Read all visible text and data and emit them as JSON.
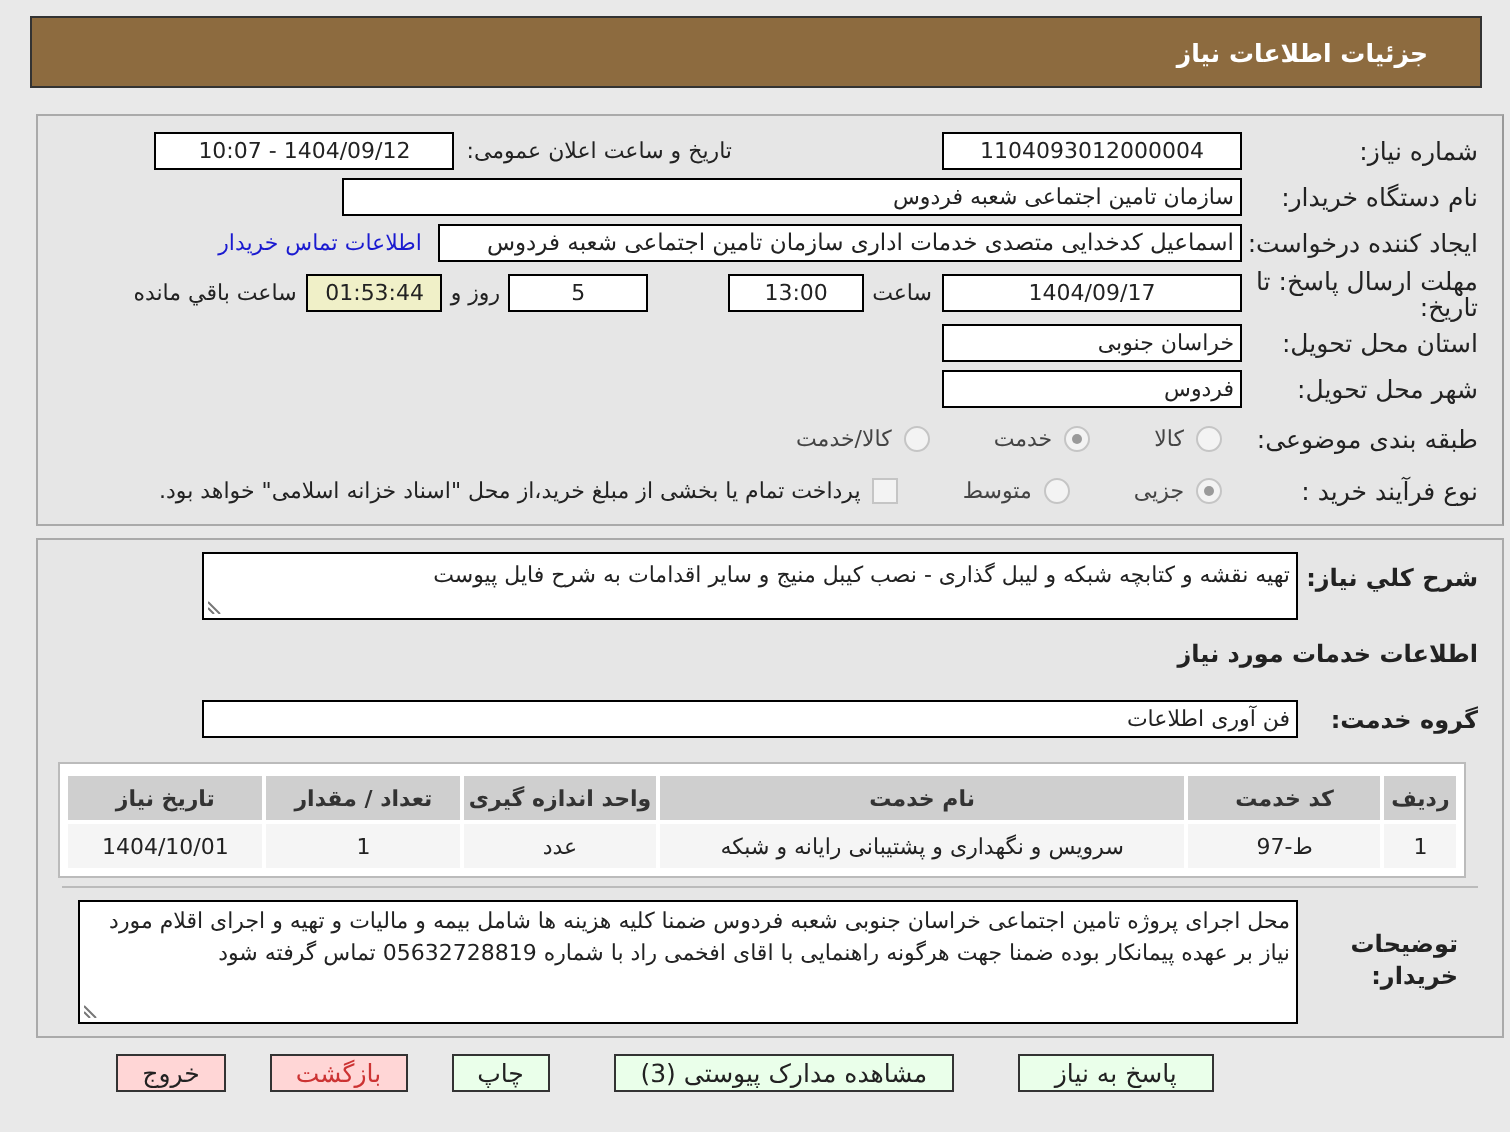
{
  "header": {
    "title": "جزئیات اطلاعات نیاز"
  },
  "need_number": {
    "label": "شماره نیاز:",
    "value": "1104093012000004"
  },
  "announce": {
    "label": "تاریخ و ساعت اعلان عمومی:",
    "value": "1404/09/12 - 10:07"
  },
  "buyer": {
    "label": "نام دستگاه خریدار:",
    "value": "سازمان تامین اجتماعی شعبه فردوس"
  },
  "requester": {
    "label": "ایجاد کننده درخواست:",
    "value": "اسماعیل کدخدایی متصدی خدمات اداری  سازمان تامین اجتماعی شعبه فردوس",
    "link": "اطلاعات تماس خریدار"
  },
  "deadline": {
    "label": "مهلت ارسال پاسخ: تا تاریخ:",
    "date": "1404/09/17",
    "time_label": "ساعت",
    "time": "13:00",
    "days": "5",
    "days_label": "روز و",
    "remaining": "01:53:44",
    "remaining_label": "ساعت باقي مانده"
  },
  "province": {
    "label": "استان محل تحویل:",
    "value": "خراسان جنوبی"
  },
  "city": {
    "label": "شهر محل تحویل:",
    "value": "فردوس"
  },
  "category": {
    "label": "طبقه بندی موضوعی:",
    "options": [
      {
        "label": "کالا",
        "selected": false
      },
      {
        "label": "خدمت",
        "selected": true
      },
      {
        "label": "کالا/خدمت",
        "selected": false
      }
    ]
  },
  "process": {
    "label": "نوع فرآیند خرید :",
    "options": [
      {
        "label": "جزیی",
        "selected": true
      },
      {
        "label": "متوسط",
        "selected": false
      }
    ],
    "payment": {
      "label": "پرداخت تمام یا بخشی از مبلغ خرید،از محل \"اسناد خزانه اسلامی\" خواهد بود.",
      "checked": false
    }
  },
  "description": {
    "label": "شرح کلي نياز:",
    "value": "تهیه نقشه و کتابچه شبکه و لیبل گذاری - نصب کیبل منیج و سایر اقدامات به شرح فایل پیوست"
  },
  "section_title": "اطلاعات خدمات مورد نیاز",
  "service_group": {
    "label": "گروه خدمت:",
    "value": "فن آوری اطلاعات"
  },
  "table": {
    "columns": [
      "ردیف",
      "کد خدمت",
      "نام خدمت",
      "واحد اندازه گیری",
      "تعداد / مقدار",
      "تاریخ نیاز"
    ],
    "rows": [
      [
        "1",
        "ط-97",
        "سرویس و نگهداری و پشتیبانی رایانه و شبکه",
        "عدد",
        "1",
        "1404/10/01"
      ]
    ]
  },
  "buyer_notes": {
    "label": "توضیحات خریدار:",
    "value": "محل اجرای پروژه تامین اجتماعی خراسان جنوبی شعبه فردوس ضمنا کلیه هزینه ها شامل بیمه و مالیات و تهیه و اجرای اقلام مورد نیاز بر عهده پیمانکار بوده ضمنا جهت هرگونه راهنمایی با اقای افخمی راد با شماره 05632728819 تماس گرفته شود"
  },
  "buttons": [
    {
      "label": "پاسخ به نیاز",
      "kind": "action"
    },
    {
      "label": "مشاهده مدارک پیوستی (3)",
      "kind": "action"
    },
    {
      "label": "چاپ",
      "kind": "action"
    },
    {
      "label": "بازگشت",
      "kind": "danger"
    },
    {
      "label": "خروج",
      "kind": "exit"
    }
  ]
}
